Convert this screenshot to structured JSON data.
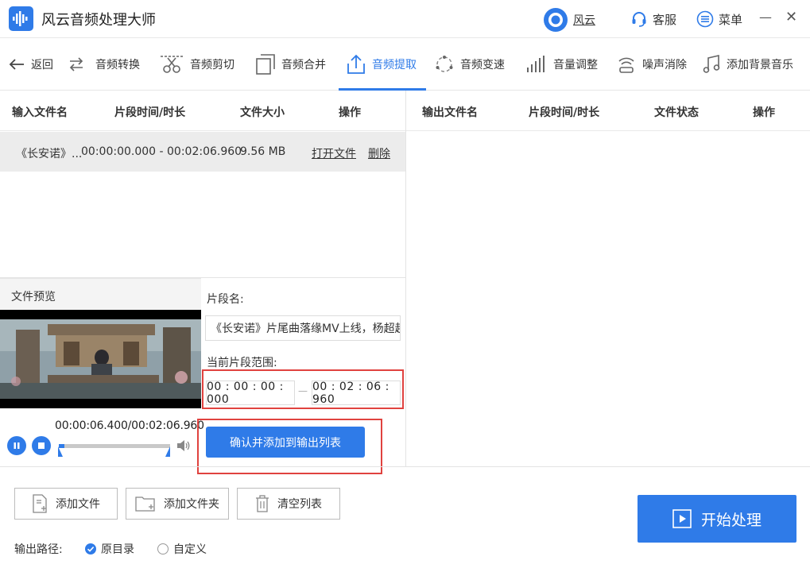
{
  "app": {
    "title": "风云音频处理大师",
    "user_label": "风云",
    "service_label": "客服",
    "menu_label": "菜单",
    "minimize_glyph": "—",
    "close_glyph": "✕"
  },
  "toolbar": {
    "back_label": "返回",
    "tools": [
      {
        "label": "音频转换",
        "icon": "convert-icon"
      },
      {
        "label": "音频剪切",
        "icon": "cut-icon"
      },
      {
        "label": "音频合并",
        "icon": "merge-icon"
      },
      {
        "label": "音频提取",
        "icon": "extract-icon",
        "active": true
      },
      {
        "label": "音频变速",
        "icon": "speed-icon"
      },
      {
        "label": "音量调整",
        "icon": "volume-bars-icon"
      },
      {
        "label": "噪声消除",
        "icon": "noise-icon"
      },
      {
        "label": "添加背景音乐",
        "icon": "music-note-icon"
      }
    ]
  },
  "input_list": {
    "headers": [
      "输入文件名",
      "片段时间/时长",
      "文件大小",
      "操作"
    ],
    "rows": [
      {
        "name": "《长安诺》...",
        "time": "00:00:00.000 - 00:02:06.960",
        "size": "9.56 MB",
        "open": "打开文件",
        "delete": "删除"
      }
    ]
  },
  "output_list": {
    "headers": [
      "输出文件名",
      "片段时间/时长",
      "文件状态",
      "操作"
    ]
  },
  "preview": {
    "title": "文件预览",
    "time_display": "00:00:06.400/00:02:06.960"
  },
  "segment": {
    "name_label": "片段名:",
    "name_value": "《长安诺》片尾曲落缘MV上线，杨超越",
    "range_label": "当前片段范围:",
    "start": "00 : 00 : 00 : 000",
    "end": "00 : 02 : 06 : 960",
    "separator": "—",
    "confirm_label": "确认并添加到输出列表"
  },
  "bottom": {
    "add_file": "添加文件",
    "add_folder": "添加文件夹",
    "clear_list": "清空列表",
    "start_label": "开始处理",
    "output_path_label": "输出路径:",
    "opt_original": "原目录",
    "opt_custom": "自定义"
  },
  "colors": {
    "accent": "#2f7be8",
    "highlight": "#e0423f"
  }
}
